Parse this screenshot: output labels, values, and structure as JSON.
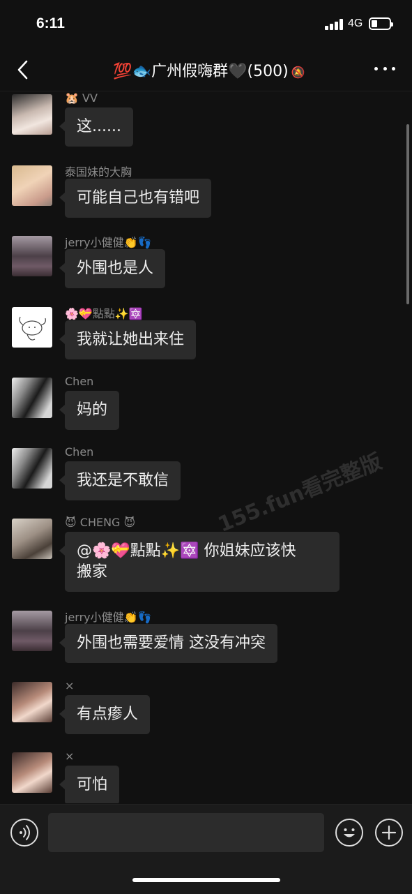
{
  "status_bar": {
    "time": "6:11",
    "network": "4G"
  },
  "header": {
    "back": "‹",
    "title": "💯🐟广州假嗨群🖤(500)",
    "mute_icon": "🔕"
  },
  "messages": [
    {
      "sender": "🐹 VV",
      "text": "这......"
    },
    {
      "sender": "泰国妹的大胸",
      "text": "可能自己也有错吧"
    },
    {
      "sender": "jerry小健健👏👣",
      "text": "外围也是人"
    },
    {
      "sender": "🌸💝點點✨🔯",
      "text": "我就让她出来住"
    },
    {
      "sender": "Chen",
      "text": "妈的"
    },
    {
      "sender": "Chen",
      "text": "我还是不敢信"
    },
    {
      "sender": "😈 CHENG 😈",
      "text_line1": "@🌸💝點點✨🔯 你姐妹应该快",
      "text_line2": "搬家"
    },
    {
      "sender": "jerry小健健👏👣",
      "text": "外围也需要爱情 这没有冲突"
    },
    {
      "sender": "×",
      "text": "有点瘆人"
    },
    {
      "sender": "×",
      "text": "可怕"
    }
  ],
  "watermark": "155.fun看完整版",
  "input_bar": {
    "voice_icon": "voice-icon",
    "emoji_icon": "smiley-icon",
    "add_icon": "plus-icon"
  },
  "colors": {
    "background": "#111111",
    "bubble": "#2b2b2b",
    "sender_text": "#8a8a8a"
  }
}
